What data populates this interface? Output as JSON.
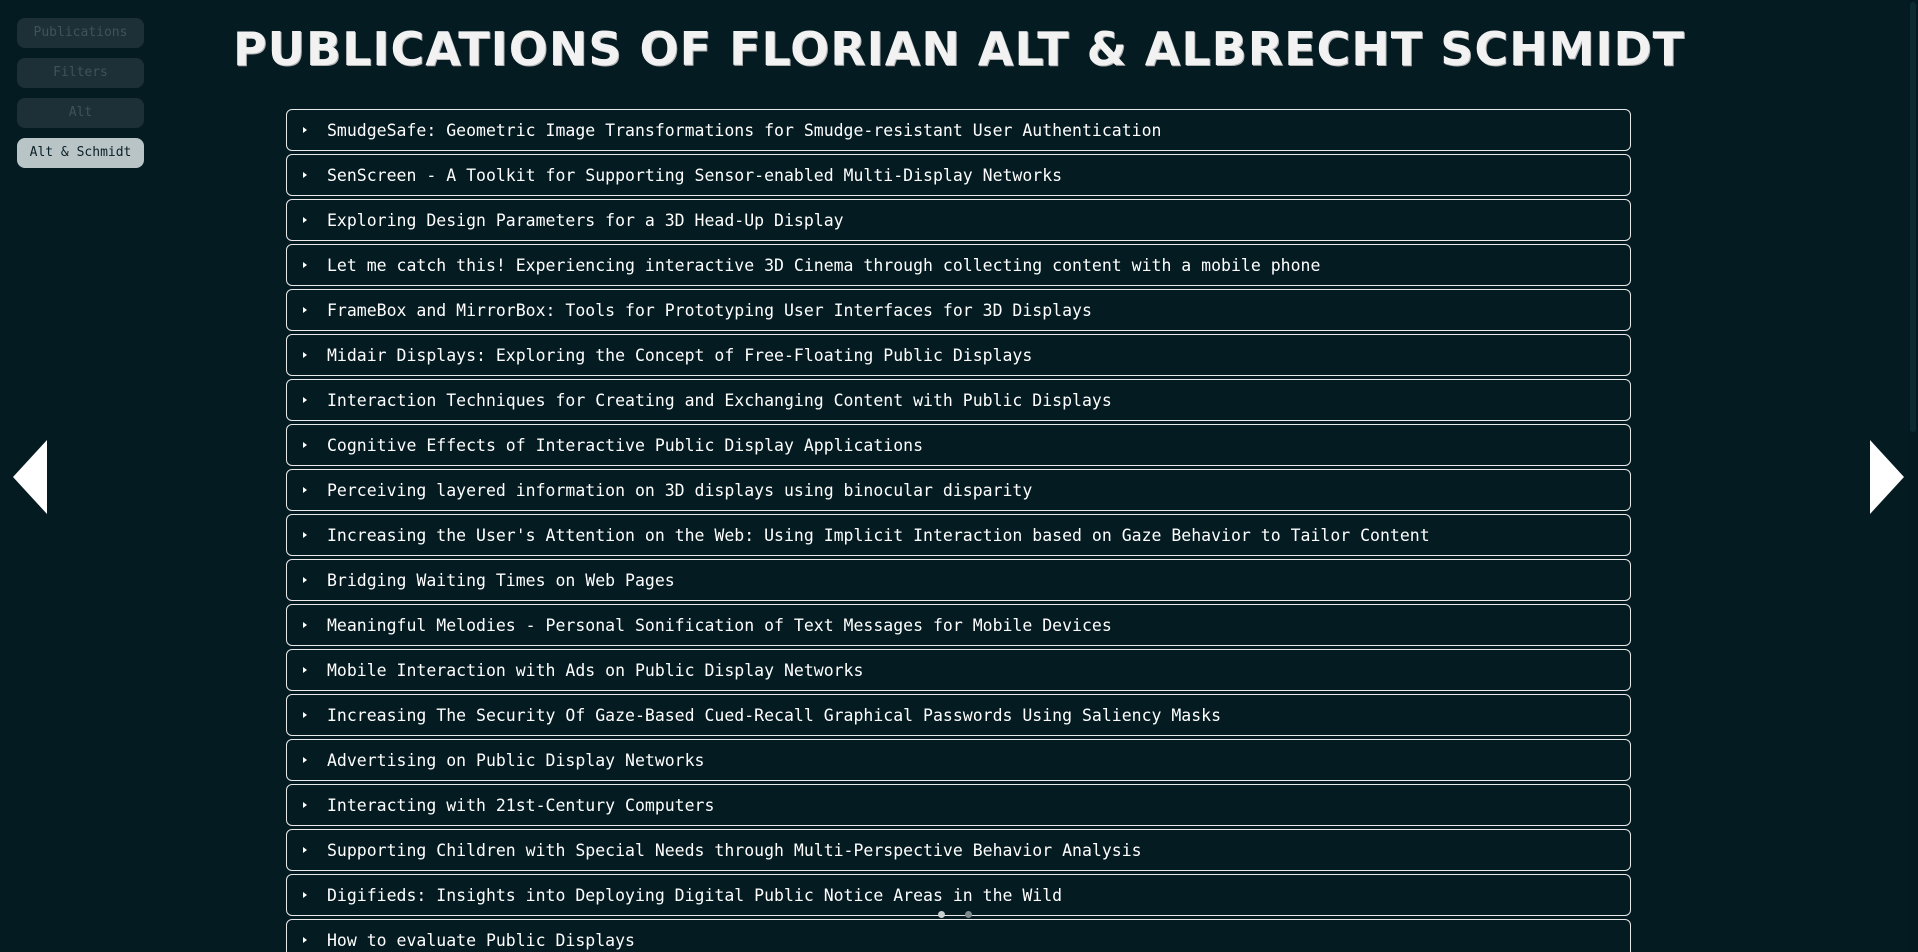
{
  "nav": {
    "buttons": [
      {
        "label": "Publications",
        "active": false
      },
      {
        "label": "Filters",
        "active": false
      },
      {
        "label": "Alt",
        "active": false
      },
      {
        "label": "Alt & Schmidt",
        "active": true
      }
    ]
  },
  "header": {
    "title": "Publications of Florian Alt & Albrecht Schmidt"
  },
  "publications": [
    "SmudgeSafe: Geometric Image Transformations for Smudge-resistant User Authentication",
    "SenScreen - A Toolkit for Supporting Sensor-enabled Multi-Display Networks",
    "Exploring Design Parameters for a 3D Head-Up Display",
    "Let me catch this! Experiencing interactive 3D Cinema through collecting content with a mobile phone",
    "FrameBox and MirrorBox: Tools for Prototyping User Interfaces for 3D Displays",
    "Midair Displays: Exploring the Concept of Free-Floating Public Displays",
    "Interaction Techniques for Creating and Exchanging Content with Public Displays",
    "Cognitive Effects of Interactive Public Display Applications",
    "Perceiving layered information on 3D displays using binocular disparity",
    "Increasing the User's Attention on the Web: Using Implicit Interaction based on Gaze Behavior to Tailor Content",
    "Bridging Waiting Times on Web Pages",
    "Meaningful Melodies - Personal Sonification of Text Messages for Mobile Devices",
    "Mobile Interaction with Ads on Public Display Networks",
    "Increasing The Security Of Gaze-Based Cued-Recall Graphical Passwords Using Saliency Masks",
    "Advertising on Public Display Networks",
    "Interacting with 21st-Century Computers",
    "Supporting Children with Special Needs through Multi-Perspective Behavior Analysis",
    "Digifieds: Insights into Deploying Digital Public Notice Areas in the Wild",
    "How to evaluate Public Displays"
  ],
  "icons": {
    "prev": "triangle-left-icon",
    "next": "triangle-right-icon",
    "expand": "caret-right-icon"
  },
  "colors": {
    "background": "#051b22",
    "text": "#ffffff",
    "active_nav": "#b9c4c6",
    "inactive_nav": "#1e3037"
  }
}
